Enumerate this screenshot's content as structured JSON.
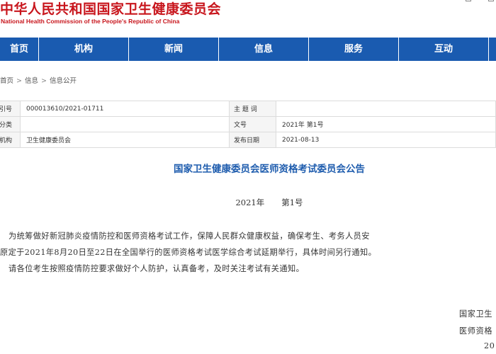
{
  "header": {
    "title": "中华人民共和国国家卫生健康委员会",
    "subtitle": "National Health Commission of the People's Republic of China",
    "top_links": [
      "",
      ""
    ]
  },
  "nav": {
    "items": [
      "首页",
      "机构",
      "新闻",
      "信息",
      "服务",
      "互动"
    ]
  },
  "breadcrumb": {
    "items": [
      "首页",
      "信息",
      "信息公开"
    ],
    "separator": ">"
  },
  "meta_table": {
    "rows": [
      {
        "k1": "引号",
        "v1": "000013610/2021-01711",
        "k2": "主 题 词",
        "v2": ""
      },
      {
        "k1": "分类",
        "v1": "",
        "k2": "文号",
        "v2": "2021年 第1号"
      },
      {
        "k1": "机构",
        "v1": "卫生健康委员会",
        "k2": "发布日期",
        "v2": "2021-08-13"
      }
    ]
  },
  "article": {
    "title": "国家卫生健康委员会医师资格考试委员会公告",
    "doc_year": "2021年",
    "doc_num": "第1号",
    "paragraphs": [
      "为统筹做好新冠肺炎疫情防控和医师资格考试工作，保障人民群众健康权益，确保考生、考务人员安",
      "原定于2021年8月20日至22日在全国举行的医师资格考试医学综合考试延期举行，具体时间另行通知。",
      "请各位考生按照疫情防控要求做好个人防护，认真备考，及时关注考试有关通知。"
    ],
    "signature": [
      "国家卫生",
      "医师资格",
      "20"
    ]
  },
  "colors": {
    "brand_red": "#c8161d",
    "nav_blue": "#1a5bb0",
    "title_blue": "#1f5dae"
  }
}
